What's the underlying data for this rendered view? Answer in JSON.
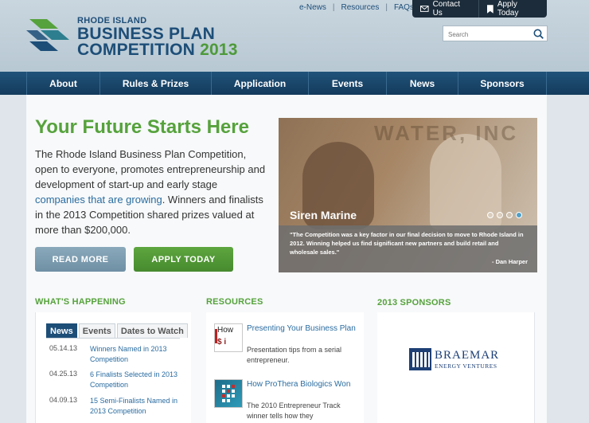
{
  "logo": {
    "small": "RHODE ISLAND",
    "line1": "BUSINESS PLAN",
    "line2": "COMPETITION",
    "year": "2013"
  },
  "top_links": [
    "e-News",
    "Resources",
    "FAQs"
  ],
  "top_tabs": [
    {
      "label": "Contact Us",
      "icon": "envelope-icon"
    },
    {
      "label": "Apply Today",
      "icon": "bookmark-icon"
    }
  ],
  "search": {
    "placeholder": "Search",
    "icon": "search-icon"
  },
  "nav": [
    "About",
    "Rules & Prizes",
    "Application",
    "Events",
    "News",
    "Sponsors"
  ],
  "hero": {
    "headline": "Your Future Starts Here",
    "intro_before": "The Rhode Island Business Plan Competition, open to everyone, promotes entrepreneurship and development of start-up and early stage ",
    "intro_link": "companies that are growing",
    "intro_after": ". Winners and finalists in the 2013 Competition shared prizes valued at more than $200,000.",
    "read_more": "READ MORE",
    "apply_today": "APPLY TODAY"
  },
  "slideshow": {
    "bg_text": "WATER, INC",
    "title": "Siren Marine",
    "quote": "\"The Competition was a key factor in our final decision to move to Rhode Island in 2012. Winning helped us find significant new partners and build retail and wholesale sales.\"",
    "author": "- Dan Harper",
    "slide_count": 4,
    "active_slide": 4
  },
  "whats_happening": {
    "heading": "WHAT'S HAPPENING",
    "tabs": [
      "News",
      "Events",
      "Dates to Watch"
    ],
    "active_tab": "News",
    "items": [
      {
        "date": "05.14.13",
        "title": "Winners Named in 2013 Competition"
      },
      {
        "date": "04.25.13",
        "title": "6 Finalists Selected in 2013 Competition"
      },
      {
        "date": "04.09.13",
        "title": "15 Semi-Finalists Named in 2013 Competition"
      }
    ]
  },
  "resources": {
    "heading": "RESOURCES",
    "items": [
      {
        "title": "Presenting Your Business Plan",
        "desc": "Presentation tips from a serial entrepreneur.",
        "thumb_text1": "How",
        "thumb_text2": "$ i"
      },
      {
        "title": "How ProThera Biologics Won",
        "desc": "The 2010 Entrepreneur Track winner tells how they"
      }
    ]
  },
  "sponsors": {
    "heading_year": "2013",
    "heading_rest": " SPONSORS",
    "sponsor_name": "BRAEMAR",
    "sponsor_sub": "ENERGY VENTURES"
  },
  "colors": {
    "brand_blue": "#1d4e78",
    "brand_green": "#56a23c",
    "nav_bg": "#143b5c"
  }
}
